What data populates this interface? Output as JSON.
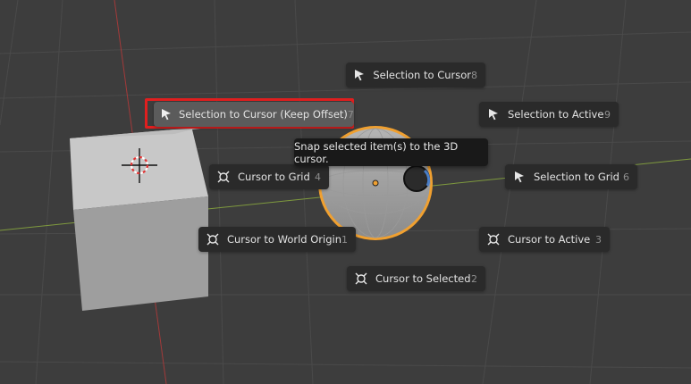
{
  "viewport": {
    "colors": {
      "background": "#3d3d3d",
      "x_axis": "#7f9a3e",
      "y_axis": "#a23a3a",
      "selection_outline": "#f0a030",
      "highlight": "#e01f1f"
    }
  },
  "pie_menu": {
    "items": [
      {
        "id": "selection-to-cursor",
        "label": "Selection to Cursor",
        "hotkey": "8",
        "icon": "cursor-arrow-icon"
      },
      {
        "id": "selection-to-cursor-keep-offset",
        "label": "Selection to Cursor (Keep Offset)",
        "hotkey": "7",
        "icon": "cursor-arrow-icon",
        "active": true
      },
      {
        "id": "selection-to-active",
        "label": "Selection to Active",
        "hotkey": "9",
        "icon": "cursor-arrow-icon"
      },
      {
        "id": "cursor-to-grid",
        "label": "Cursor to Grid",
        "hotkey": "4",
        "icon": "3d-cursor-icon"
      },
      {
        "id": "selection-to-grid",
        "label": "Selection to Grid",
        "hotkey": "6",
        "icon": "cursor-arrow-icon"
      },
      {
        "id": "cursor-to-world-origin",
        "label": "Cursor to World Origin",
        "hotkey": "1",
        "icon": "3d-cursor-icon"
      },
      {
        "id": "cursor-to-active",
        "label": "Cursor to Active",
        "hotkey": "3",
        "icon": "3d-cursor-icon"
      },
      {
        "id": "cursor-to-selected",
        "label": "Cursor to Selected",
        "hotkey": "2",
        "icon": "3d-cursor-icon"
      }
    ]
  },
  "tooltip": {
    "text": "Snap selected item(s) to the 3D cursor."
  }
}
